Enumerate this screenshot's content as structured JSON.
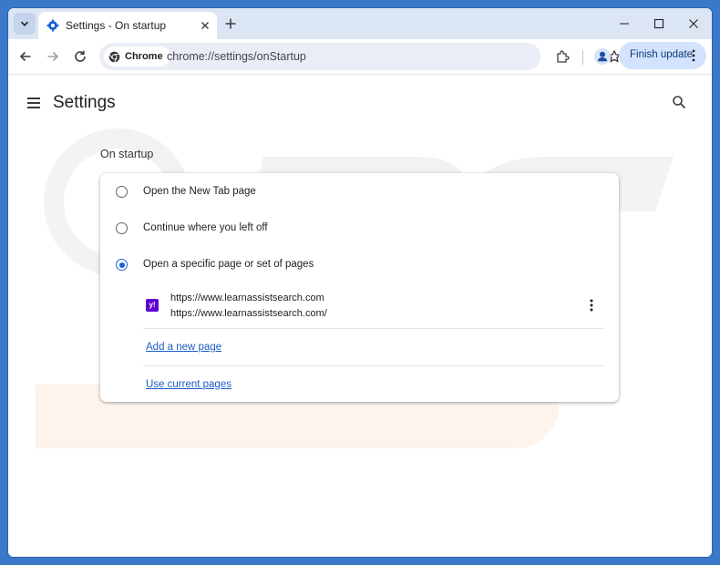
{
  "browser": {
    "tab_title": "Settings - On startup",
    "chip_label": "Chrome",
    "url": "chrome://settings/onStartup",
    "update_button": "Finish update"
  },
  "settings": {
    "title": "Settings",
    "section_title": "On startup",
    "options": [
      {
        "label": "Open the New Tab page",
        "checked": false
      },
      {
        "label": "Continue where you left off",
        "checked": false
      },
      {
        "label": "Open a specific page or set of pages",
        "checked": true
      }
    ],
    "startup_page": {
      "title": "https://www.learnassistsearch.com",
      "url": "https://www.learnassistsearch.com/",
      "favicon": "y!"
    },
    "add_link": "Add a new page",
    "use_current_link": "Use current pages"
  },
  "colors": {
    "accent": "#1a62d2",
    "favicon_bg": "#5f01d1",
    "update_bg": "#d3e3fd",
    "frame": "#dbe5f4"
  },
  "icons": [
    "tab-search-icon",
    "settings-gear-icon",
    "close-icon",
    "plus-icon",
    "minimize-icon",
    "maximize-icon",
    "back-arrow-icon",
    "forward-arrow-icon",
    "reload-icon",
    "chrome-logo-icon",
    "bookmark-star-icon",
    "extensions-puzzle-icon",
    "profile-icon",
    "more-vert-icon",
    "hamburger-menu-icon",
    "search-icon"
  ]
}
